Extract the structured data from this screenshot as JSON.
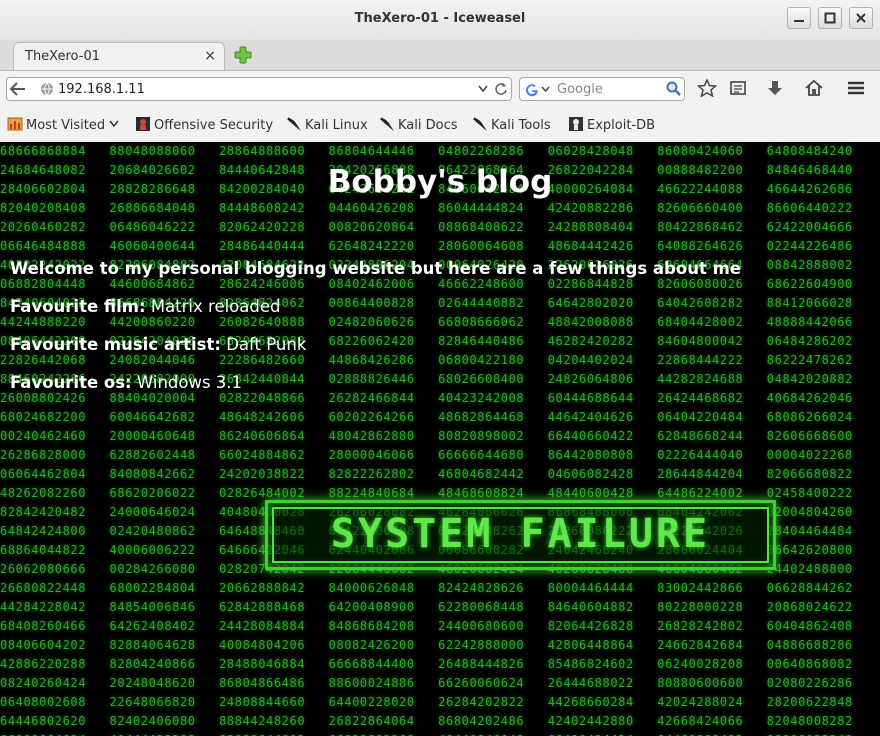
{
  "window": {
    "title": "TheXero-01 - Iceweasel"
  },
  "tab": {
    "label": "TheXero-01",
    "close": "×"
  },
  "navbar": {
    "url": "192.168.1.11",
    "search_placeholder": "Google"
  },
  "bookmarks": [
    {
      "label": "Most Visited",
      "icon": "most-visited-icon",
      "dropdown": true
    },
    {
      "label": "Offensive Security",
      "icon": "offsec-icon"
    },
    {
      "label": "Kali Linux",
      "icon": "kali-dragon-icon"
    },
    {
      "label": "Kali Docs",
      "icon": "kali-dragon-icon"
    },
    {
      "label": "Kali Tools",
      "icon": "kali-dragon-icon"
    },
    {
      "label": "Exploit-DB",
      "icon": "exploitdb-icon"
    }
  ],
  "page": {
    "heading": "Bobby's blog",
    "intro": "Welcome to my personal blogging website but here are a few things about me",
    "facts": [
      {
        "label": "Favourite film:",
        "value": "Matrix reloaded"
      },
      {
        "label": "Favourite music artist:",
        "value": "Daft Punk"
      },
      {
        "label": "Favourite os:",
        "value": "Windows 3.1"
      }
    ],
    "banner": "SYSTEM FAILURE"
  },
  "colors": {
    "matrix_green": "#2fbf2a",
    "background": "#000000",
    "text": "#ffffff"
  }
}
